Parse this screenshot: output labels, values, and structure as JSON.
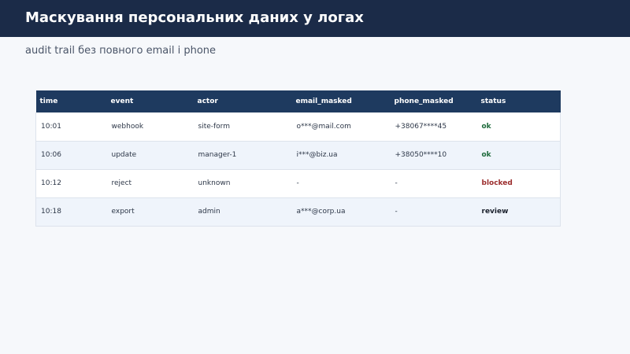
{
  "header": {
    "title": "Маскування персональних даних у логах",
    "subtitle": "audit trail без повного email і phone"
  },
  "colors": {
    "header_bg": "#1b2b48",
    "table_header_bg": "#1e3a5f",
    "status_ok": "#1e6b3c",
    "status_blocked": "#9b2c2c",
    "status_review": "#1a202c"
  },
  "table": {
    "columns": [
      "time",
      "event",
      "actor",
      "email_masked",
      "phone_masked",
      "status"
    ],
    "rows": [
      {
        "time": "10:01",
        "event": "webhook",
        "actor": "site-form",
        "email_masked": "o***@mail.com",
        "phone_masked": "+38067****45",
        "status": "ok"
      },
      {
        "time": "10:06",
        "event": "update",
        "actor": "manager-1",
        "email_masked": "i***@biz.ua",
        "phone_masked": "+38050****10",
        "status": "ok"
      },
      {
        "time": "10:12",
        "event": "reject",
        "actor": "unknown",
        "email_masked": "-",
        "phone_masked": "-",
        "status": "blocked"
      },
      {
        "time": "10:18",
        "event": "export",
        "actor": "admin",
        "email_masked": "a***@corp.ua",
        "phone_masked": "-",
        "status": "review"
      }
    ]
  }
}
